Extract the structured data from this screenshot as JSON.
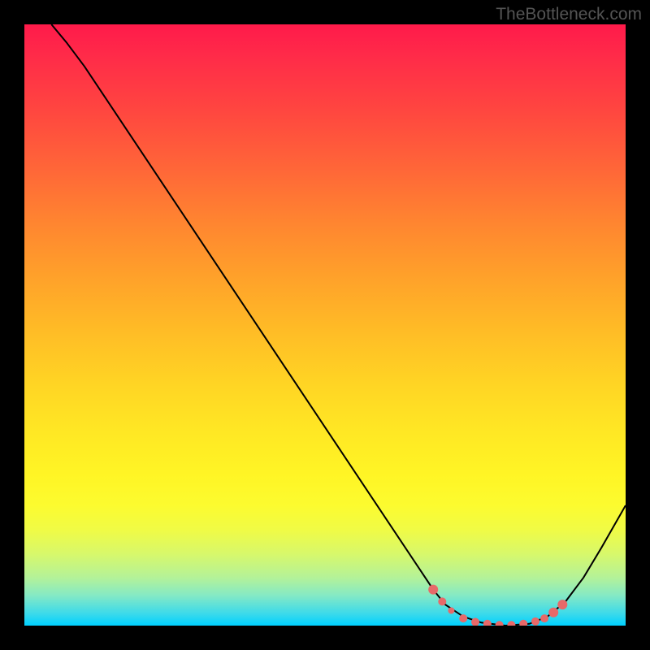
{
  "watermark": "TheBottleneck.com",
  "chart_data": {
    "type": "line",
    "title": "",
    "xlabel": "",
    "ylabel": "",
    "xlim": [
      0,
      100
    ],
    "ylim": [
      0,
      100
    ],
    "curve": {
      "name": "bottleneck-curve",
      "points": [
        {
          "x": 4.5,
          "y": 100
        },
        {
          "x": 7,
          "y": 97
        },
        {
          "x": 10,
          "y": 93
        },
        {
          "x": 15,
          "y": 85.5
        },
        {
          "x": 20,
          "y": 78
        },
        {
          "x": 25,
          "y": 70.5
        },
        {
          "x": 30,
          "y": 63
        },
        {
          "x": 35,
          "y": 55.5
        },
        {
          "x": 40,
          "y": 48
        },
        {
          "x": 45,
          "y": 40.5
        },
        {
          "x": 50,
          "y": 33
        },
        {
          "x": 55,
          "y": 25.5
        },
        {
          "x": 60,
          "y": 18
        },
        {
          "x": 65,
          "y": 10.5
        },
        {
          "x": 68,
          "y": 6
        },
        {
          "x": 70,
          "y": 3.5
        },
        {
          "x": 73,
          "y": 1.5
        },
        {
          "x": 76,
          "y": 0.5
        },
        {
          "x": 80,
          "y": 0
        },
        {
          "x": 84,
          "y": 0.3
        },
        {
          "x": 87,
          "y": 1.5
        },
        {
          "x": 90,
          "y": 4
        },
        {
          "x": 93,
          "y": 8
        },
        {
          "x": 96,
          "y": 13
        },
        {
          "x": 100,
          "y": 20
        }
      ]
    },
    "markers": [
      {
        "x": 68,
        "y": 6,
        "size": 6
      },
      {
        "x": 69.5,
        "y": 4,
        "size": 5
      },
      {
        "x": 71,
        "y": 2.5,
        "size": 4
      },
      {
        "x": 73,
        "y": 1.2,
        "size": 5
      },
      {
        "x": 75,
        "y": 0.6,
        "size": 5
      },
      {
        "x": 77,
        "y": 0.3,
        "size": 5
      },
      {
        "x": 79,
        "y": 0.1,
        "size": 5
      },
      {
        "x": 81,
        "y": 0.1,
        "size": 5
      },
      {
        "x": 83,
        "y": 0.3,
        "size": 5
      },
      {
        "x": 85,
        "y": 0.7,
        "size": 5
      },
      {
        "x": 86.5,
        "y": 1.2,
        "size": 5
      },
      {
        "x": 88,
        "y": 2.2,
        "size": 6
      },
      {
        "x": 89.5,
        "y": 3.5,
        "size": 6
      }
    ],
    "marker_color": "#e76969",
    "curve_color": "#000000",
    "curve_width": 2
  }
}
